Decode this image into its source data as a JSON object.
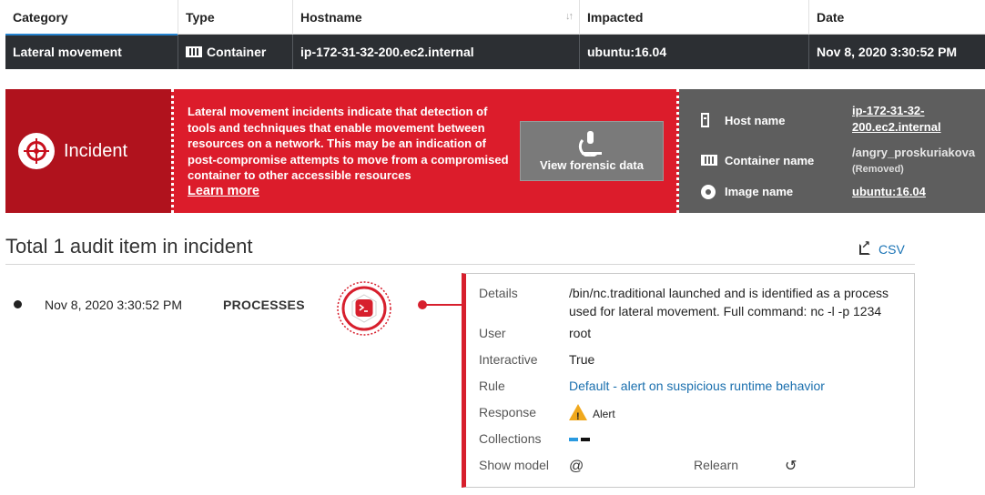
{
  "table": {
    "headers": {
      "category": "Category",
      "type": "Type",
      "hostname": "Hostname",
      "impacted": "Impacted",
      "date": "Date"
    },
    "row": {
      "category": "Lateral movement",
      "type": "Container",
      "hostname": "ip-172-31-32-200.ec2.internal",
      "impacted": "ubuntu:16.04",
      "date": "Nov 8, 2020 3:30:52 PM"
    }
  },
  "banner": {
    "title": "Incident",
    "description": "Lateral movement incidents indicate that detection of tools and techniques that enable movement between resources on a network. This may be an indication of post-compromise attempts to move from a compromised container to other accessible resources",
    "learn_more": "Learn more",
    "forensic_button": "View forensic data",
    "host_label": "Host name",
    "host_value_line1": "ip-172-31-32-",
    "host_value_line2": "200.ec2.internal",
    "container_label": "Container name",
    "container_value": "/angry_proskuriakova",
    "container_status": "(Removed)",
    "image_label": "Image name",
    "image_value": "ubuntu:16.04"
  },
  "audit": {
    "title": "Total 1 audit item in incident",
    "csv_label": "CSV",
    "event": {
      "date": "Nov 8, 2020 3:30:52 PM",
      "type": "PROCESSES"
    },
    "details": {
      "details_label": "Details",
      "details_line1": "/bin/nc.traditional launched and is identified as a process",
      "details_line2": "used for lateral movement. Full command: nc -l -p 1234",
      "user_label": "User",
      "user_value": "root",
      "interactive_label": "Interactive",
      "interactive_value": "True",
      "rule_label": "Rule",
      "rule_value": "Default - alert on suspicious runtime behavior",
      "response_label": "Response",
      "response_value": "Alert",
      "collections_label": "Collections",
      "show_model_label": "Show model",
      "relearn_label": "Relearn"
    }
  },
  "colors": {
    "accent_blue": "#2684d0",
    "incident_red": "#dc1c2b",
    "incident_dark_red": "#b0121d",
    "link_blue": "#1a6fae",
    "warning": "#f0a81c",
    "collection_blue": "#2a9ae0",
    "collection_black": "#111111"
  },
  "icons": [
    "container-icon",
    "crosshair-icon",
    "microscope-icon",
    "server-icon",
    "disc-icon",
    "export-icon",
    "terminal-badge-icon",
    "warning-icon",
    "at-sign-icon",
    "relearn-icon",
    "sort-icon"
  ]
}
